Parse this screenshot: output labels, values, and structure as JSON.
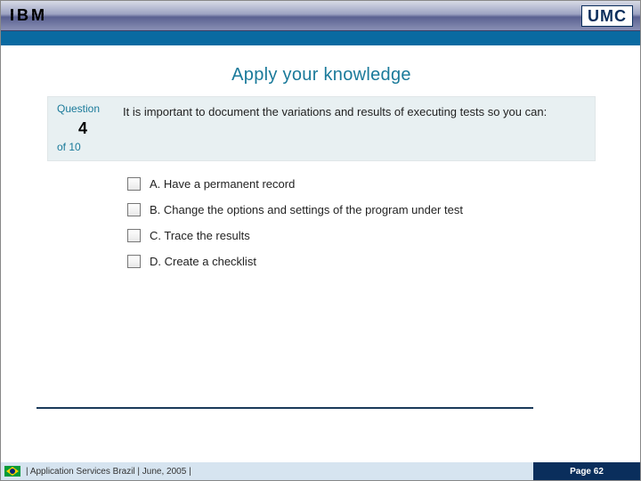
{
  "header": {
    "logo_left": "IBM",
    "logo_right": "UMC"
  },
  "title": "Apply your knowledge",
  "question": {
    "label_top": "Question",
    "number": "4",
    "label_bottom": "of 10",
    "text": "It is important to document the variations and results of executing tests so you can:"
  },
  "options": [
    {
      "label": "A. Have a permanent record"
    },
    {
      "label": "B. Change the options and settings of the program under test"
    },
    {
      "label": "C. Trace the results"
    },
    {
      "label": "D. Create a checklist"
    }
  ],
  "footer": {
    "left": " |  Application Services Brazil  |  June, 2005  |",
    "right": "Page 62"
  }
}
